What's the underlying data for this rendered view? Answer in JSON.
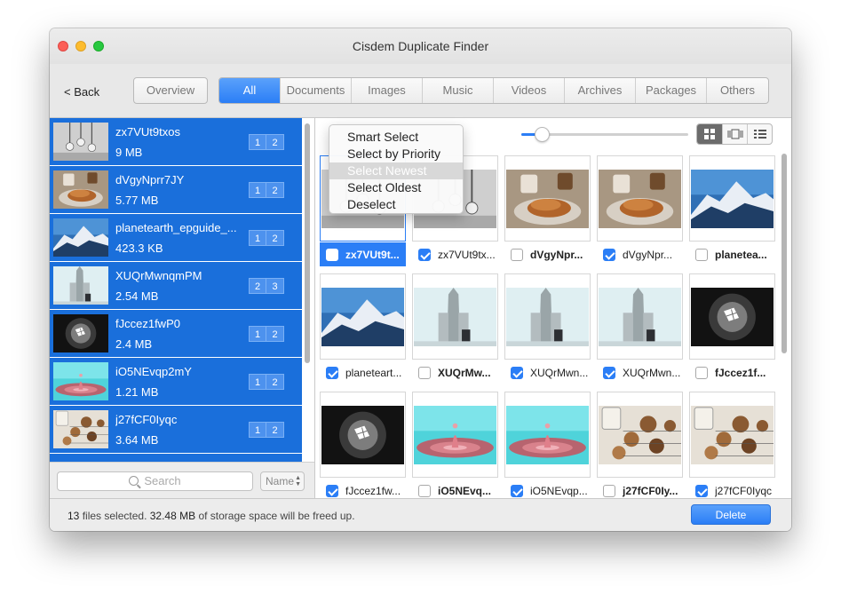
{
  "window": {
    "title": "Cisdem Duplicate Finder"
  },
  "toolbar": {
    "back_label": "< Back",
    "overview_label": "Overview",
    "tabs": [
      "All",
      "Documents",
      "Images",
      "Music",
      "Videos",
      "Archives",
      "Packages",
      "Others"
    ],
    "active_tab": "All"
  },
  "groups": [
    {
      "name": "zx7VUt9txos",
      "size": "9 MB",
      "badge": [
        "1",
        "2"
      ],
      "thumb": "light-bulbs"
    },
    {
      "name": "dVgyNprr7JY",
      "size": "5.77 MB",
      "badge": [
        "1",
        "2"
      ],
      "thumb": "croissant"
    },
    {
      "name": "planetearth_epguide_...",
      "size": "423.3 KB",
      "badge": [
        "1",
        "2"
      ],
      "thumb": "mountain"
    },
    {
      "name": "XUQrMwnqmPM",
      "size": "2.54 MB",
      "badge": [
        "2",
        "3"
      ],
      "thumb": "church"
    },
    {
      "name": "fJccez1fwP0",
      "size": "2.4 MB",
      "badge": [
        "1",
        "2"
      ],
      "thumb": "skylight"
    },
    {
      "name": "iO5NEvqp2mY",
      "size": "1.21 MB",
      "badge": [
        "1",
        "2"
      ],
      "thumb": "water-drop"
    },
    {
      "name": "j27fCF0Iyqc",
      "size": "3.64 MB",
      "badge": [
        "1",
        "2"
      ],
      "thumb": "cookies"
    }
  ],
  "search": {
    "placeholder": "Search",
    "sort_label": "Name"
  },
  "context_menu": {
    "items": [
      "Smart Select",
      "Select by Priority",
      "Select Newest",
      "Select Oldest",
      "Deselect"
    ],
    "highlighted": "Select Newest"
  },
  "view_modes": [
    "grid-icon",
    "filmstrip-icon",
    "list-icon"
  ],
  "thumb_size_slider": 0.12,
  "files": [
    {
      "name": "zx7VUt9t...",
      "checked": false,
      "bold": true,
      "selected": true,
      "thumb": "light-bulbs"
    },
    {
      "name": "zx7VUt9tx...",
      "checked": true,
      "bold": false,
      "selected": false,
      "thumb": "light-bulbs"
    },
    {
      "name": "dVgyNpr...",
      "checked": false,
      "bold": true,
      "selected": false,
      "thumb": "croissant"
    },
    {
      "name": "dVgyNpr...",
      "checked": true,
      "bold": false,
      "selected": false,
      "thumb": "croissant"
    },
    {
      "name": "planetea...",
      "checked": false,
      "bold": true,
      "selected": false,
      "thumb": "mountain"
    },
    {
      "name": "planeteart...",
      "checked": true,
      "bold": false,
      "selected": false,
      "thumb": "mountain"
    },
    {
      "name": "XUQrMw...",
      "checked": false,
      "bold": true,
      "selected": false,
      "thumb": "church"
    },
    {
      "name": "XUQrMwn...",
      "checked": true,
      "bold": false,
      "selected": false,
      "thumb": "church"
    },
    {
      "name": "XUQrMwn...",
      "checked": true,
      "bold": false,
      "selected": false,
      "thumb": "church"
    },
    {
      "name": "fJccez1f...",
      "checked": false,
      "bold": true,
      "selected": false,
      "thumb": "skylight"
    },
    {
      "name": "fJccez1fw...",
      "checked": true,
      "bold": false,
      "selected": false,
      "thumb": "skylight"
    },
    {
      "name": "iO5NEvq...",
      "checked": false,
      "bold": true,
      "selected": false,
      "thumb": "water-drop"
    },
    {
      "name": "iO5NEvqp...",
      "checked": true,
      "bold": false,
      "selected": false,
      "thumb": "water-drop"
    },
    {
      "name": "j27fCF0Iy...",
      "checked": false,
      "bold": true,
      "selected": false,
      "thumb": "cookies"
    },
    {
      "name": "j27fCF0Iyqc",
      "checked": true,
      "bold": false,
      "selected": false,
      "thumb": "cookies"
    }
  ],
  "status": {
    "count": "13",
    "text_a": " files selected. ",
    "size": "32.48 MB",
    "text_b": " of storage space will be freed up."
  },
  "delete_label": "Delete",
  "colors": {
    "accent": "#2b7ef6",
    "selection": "#1a6fdb"
  }
}
